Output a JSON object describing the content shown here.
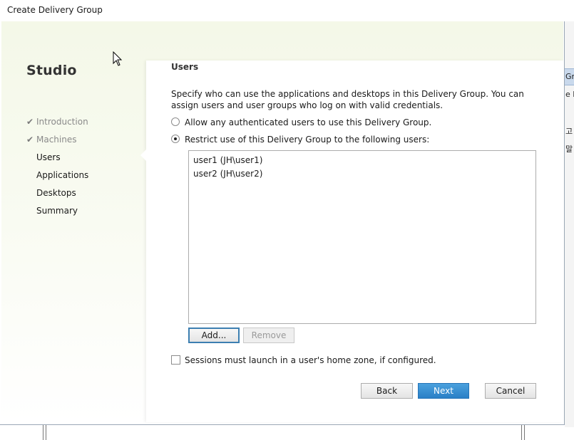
{
  "window": {
    "title": "Create Delivery Group"
  },
  "sidebar": {
    "brand": "Studio",
    "steps": [
      {
        "label": "Introduction",
        "state": "done"
      },
      {
        "label": "Machines",
        "state": "done"
      },
      {
        "label": "Users",
        "state": "current"
      },
      {
        "label": "Applications",
        "state": "pending"
      },
      {
        "label": "Desktops",
        "state": "pending"
      },
      {
        "label": "Summary",
        "state": "pending"
      }
    ]
  },
  "main": {
    "section_title": "Users",
    "description": "Specify who can use the applications and desktops in this Delivery Group. You can assign users and user groups who log on with valid credentials.",
    "options": {
      "allow_all_label": "Allow any authenticated users to use this Delivery Group.",
      "allow_all_selected": false,
      "restrict_label": "Restrict use of this Delivery Group to the following users:",
      "restrict_selected": true
    },
    "users": [
      "user1 (JH\\user1)",
      "user2 (JH\\user2)"
    ],
    "add_button": "Add...",
    "remove_button": "Remove",
    "home_zone_label": "Sessions must launch in a user's home zone, if configured.",
    "home_zone_checked": false
  },
  "footer": {
    "back_button": "Back",
    "next_button": "Next",
    "cancel_button": "Cancel"
  },
  "background": {
    "fragments": [
      "Gro",
      "e I",
      "고",
      "말"
    ]
  },
  "colors": {
    "accent": "#2a7fc6",
    "focus_border": "#3c7fb1"
  }
}
